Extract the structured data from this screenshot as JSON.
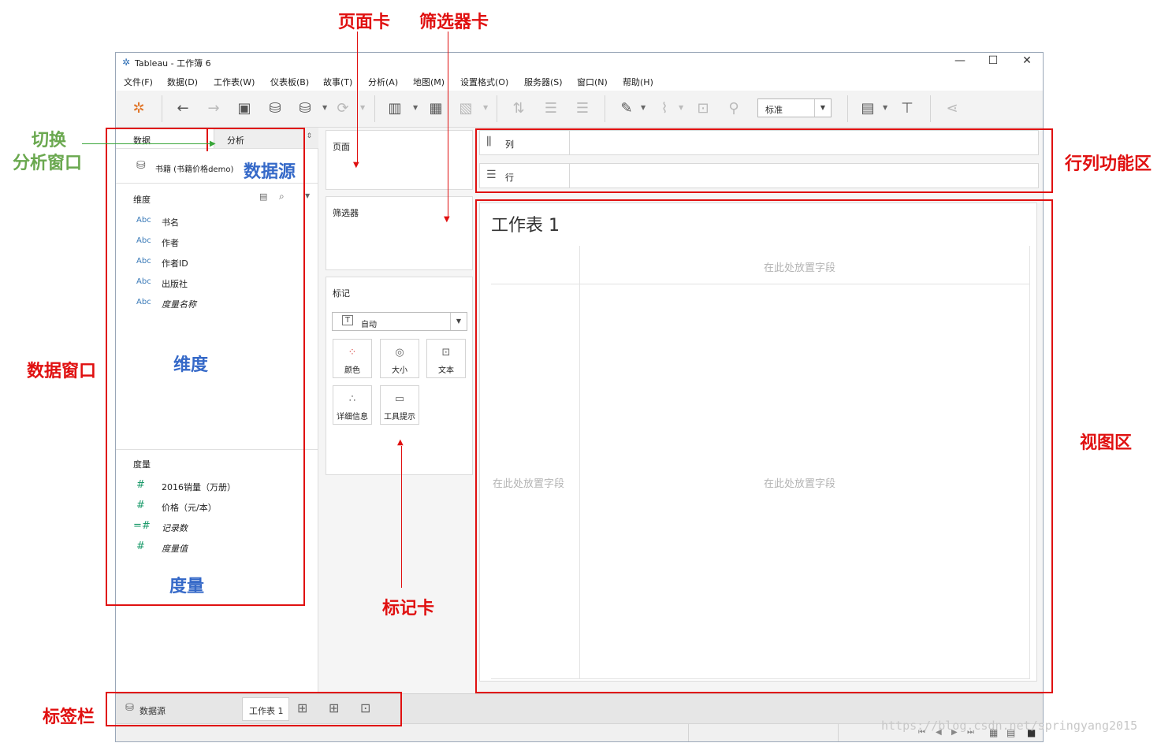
{
  "window": {
    "title": "Tableau - 工作簿 6",
    "controls": {
      "minimize": "—",
      "maximize": "☐",
      "close": "✕"
    }
  },
  "menu": [
    "文件(F)",
    "数据(D)",
    "工作表(W)",
    "仪表板(B)",
    "故事(T)",
    "分析(A)",
    "地图(M)",
    "设置格式(O)",
    "服务器(S)",
    "窗口(N)",
    "帮助(H)"
  ],
  "toolbar": {
    "standard_select": "标准",
    "icons": [
      "tableau-logo-icon",
      "back-icon",
      "forward-icon",
      "save-icon",
      "new-datasource-icon",
      "pause-autoupdate-icon",
      "refresh-icon",
      "new-worksheet-icon",
      "duplicate-icon",
      "clear-sheet-icon",
      "swap-icon",
      "sort-asc-icon",
      "sort-desc-icon",
      "highlight-icon",
      "group-icon",
      "label-icon",
      "pin-icon",
      "show-cards-icon",
      "presentation-icon",
      "share-icon"
    ]
  },
  "data_pane": {
    "tab_data": "数据",
    "tab_analysis": "分析",
    "datasource": "书籍 (书籍价格demo)",
    "dimensions_title": "维度",
    "dimensions": [
      {
        "type": "Abc",
        "name": "书名",
        "italic": false
      },
      {
        "type": "Abc",
        "name": "作者",
        "italic": false
      },
      {
        "type": "Abc",
        "name": "作者ID",
        "italic": false
      },
      {
        "type": "Abc",
        "name": "出版社",
        "italic": false
      },
      {
        "type": "Abc",
        "name": "度量名称",
        "italic": true
      }
    ],
    "measures_title": "度量",
    "measures": [
      {
        "type": "#",
        "name": "2016销量（万册）",
        "italic": false
      },
      {
        "type": "#",
        "name": "价格（元/本）",
        "italic": false
      },
      {
        "type": "=#",
        "name": "记录数",
        "italic": true
      },
      {
        "type": "#",
        "name": "度量值",
        "italic": true
      }
    ]
  },
  "cards": {
    "pages_title": "页面",
    "filters_title": "筛选器",
    "marks_title": "标记",
    "marks_type": "自动",
    "mark_buttons": [
      "颜色",
      "大小",
      "文本",
      "详细信息",
      "工具提示"
    ]
  },
  "shelves": {
    "columns_label": "列",
    "rows_label": "行"
  },
  "view": {
    "sheet_title": "工作表 1",
    "drop_field_top": "在此处放置字段",
    "drop_field_left": "在此处放置字段",
    "drop_field_center": "在此处放置字段"
  },
  "tabs": {
    "datasource_tab": "数据源",
    "sheet_tab": "工作表 1"
  },
  "annotations": {
    "pages_card": "页面卡",
    "filters_card": "筛选器卡",
    "switch_line1": "切换",
    "switch_line2": "分析窗口",
    "datasource": "数据源",
    "data_window": "数据窗口",
    "dimensions": "维度",
    "measures": "度量",
    "marks_card": "标记卡",
    "rowcol_area": "行列功能区",
    "view_area": "视图区",
    "tab_bar": "标签栏"
  },
  "watermark": "https://blog.csdn.net/springyang2015",
  "colors": {
    "annotation_red": "#e01010",
    "annotation_blue": "#3569c8",
    "annotation_green": "#6aa84f"
  }
}
